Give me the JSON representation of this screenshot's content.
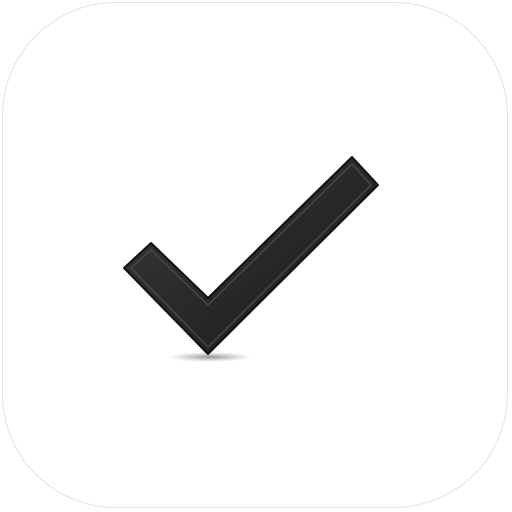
{
  "app_icon": {
    "icon": "checkmark-icon",
    "background_color": "#ffffff",
    "border_color": "#e2e2e2",
    "glyph_color": "#2b2b2b",
    "shadow_color": "#8c8c8c"
  }
}
